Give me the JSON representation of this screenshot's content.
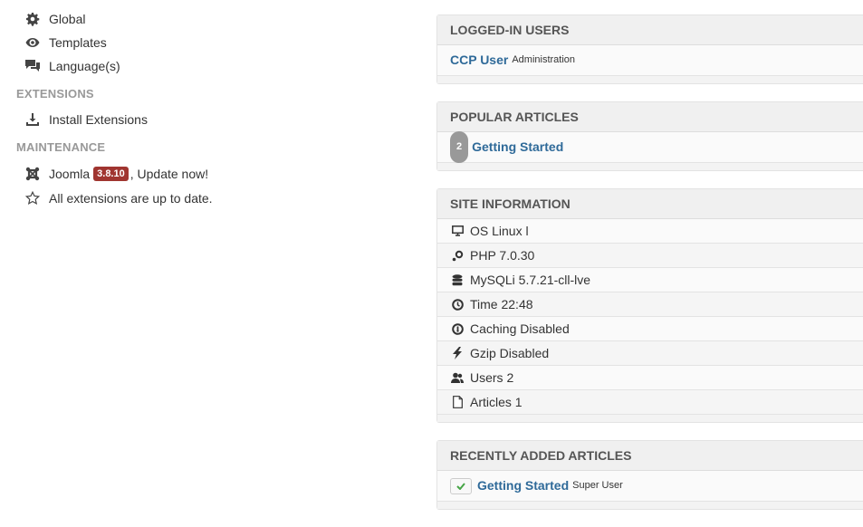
{
  "sidebar": {
    "config_items": [
      {
        "icon": "gear-icon",
        "label": "Global"
      },
      {
        "icon": "eye-icon",
        "label": "Templates"
      },
      {
        "icon": "comments-icon",
        "label": "Language(s)"
      }
    ],
    "extensions": {
      "heading": "EXTENSIONS",
      "items": [
        {
          "icon": "download-icon",
          "label": "Install Extensions"
        }
      ]
    },
    "maintenance": {
      "heading": "MAINTENANCE",
      "joomla_prefix": "Joomla",
      "joomla_version": "3.8.10",
      "joomla_suffix": ", Update now!",
      "extensions_status": "All extensions are up to date."
    }
  },
  "panels": {
    "logged_in": {
      "title": "LOGGED-IN USERS",
      "users": [
        {
          "name": "CCP User",
          "area": "Administration"
        }
      ]
    },
    "popular": {
      "title": "POPULAR ARTICLES",
      "articles": [
        {
          "hits": "2",
          "title": "Getting Started"
        }
      ]
    },
    "site_info": {
      "title": "SITE INFORMATION",
      "rows": [
        {
          "icon": "monitor-icon",
          "text": "OS Linux l"
        },
        {
          "icon": "php-icon",
          "text": "PHP 7.0.30"
        },
        {
          "icon": "database-icon",
          "text": "MySQLi 5.7.21-cll-lve"
        },
        {
          "icon": "clock-icon",
          "text": "Time 22:48"
        },
        {
          "icon": "dashboard-icon",
          "text": "Caching Disabled"
        },
        {
          "icon": "lightning-icon",
          "text": "Gzip Disabled"
        },
        {
          "icon": "users-icon",
          "text": "Users 2"
        },
        {
          "icon": "file-icon",
          "text": "Articles 1"
        }
      ]
    },
    "recent": {
      "title": "RECENTLY ADDED ARTICLES",
      "articles": [
        {
          "title": "Getting Started",
          "author": "Super User",
          "published": true
        }
      ]
    }
  },
  "colors": {
    "link": "#2f6a99",
    "update_badge": "#a03530",
    "published_check": "#46a546"
  }
}
